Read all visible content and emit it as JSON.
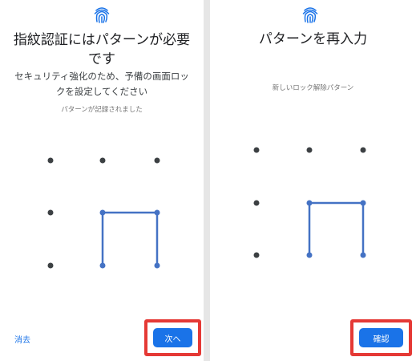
{
  "screen1": {
    "title": "指紋認証にはパターンが必要です",
    "subtitle": "セキュリティ強化のため、予備の画面ロックを設定してください",
    "status": "パターンが記録されました",
    "clear_label": "消去",
    "next_label": "次へ",
    "icon": "fingerprint-icon"
  },
  "screen2": {
    "title": "パターンを再入力",
    "status": "新しいロック解除パターン",
    "confirm_label": "確認",
    "icon": "fingerprint-icon"
  },
  "colors": {
    "accent": "#1a73e8",
    "highlight": "#e53935",
    "dot": "#3c4043"
  }
}
